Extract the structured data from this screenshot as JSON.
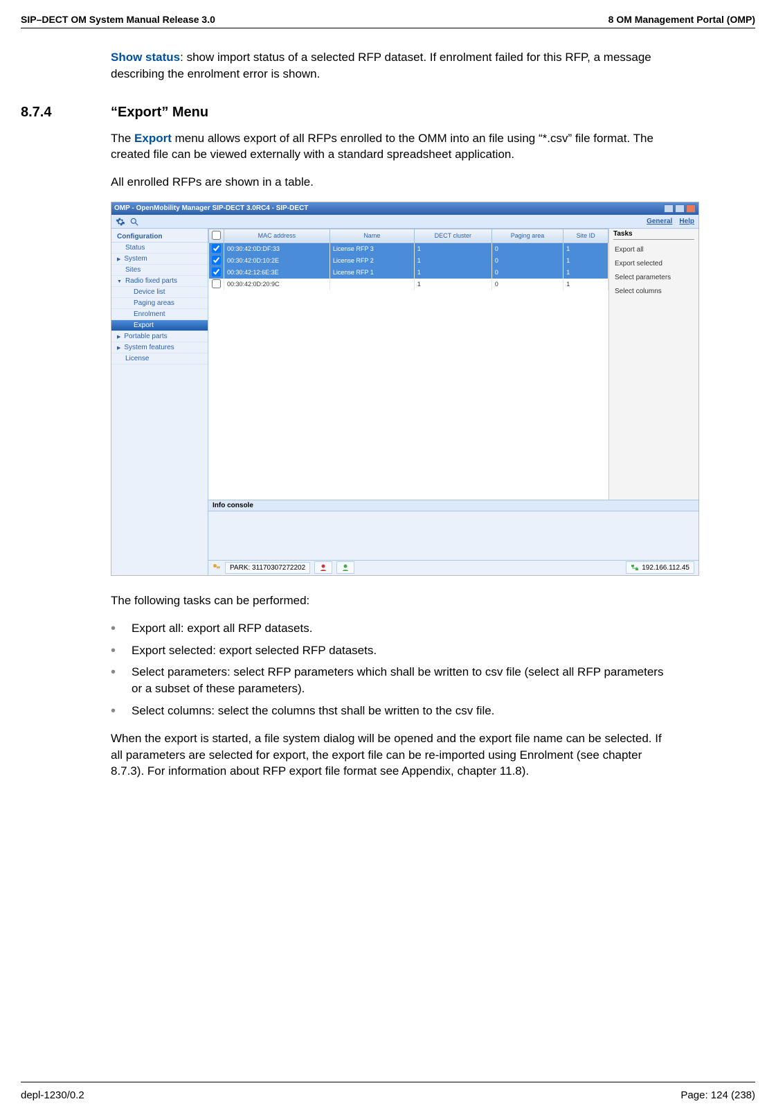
{
  "header": {
    "left": "SIP–DECT OM System Manual Release 3.0",
    "right": "8 OM Management Portal (OMP)"
  },
  "intro": {
    "show_status_label": "Show status",
    "show_status_text": ": show import status of a selected RFP dataset. If enrolment failed for this RFP, a message describing the enrolment error is shown."
  },
  "section": {
    "num": "8.7.4",
    "title": "“Export” Menu"
  },
  "body": {
    "p1a": "The ",
    "p1_export": "Export",
    "p1b": " menu allows export of all RFPs enrolled to the OMM into an file using “*.csv” file format. The created file can be viewed externally with a standard spreadsheet application.",
    "p2": "All enrolled RFPs are shown in a table.",
    "p3": "The following tasks can be performed:",
    "p4": "When the export is started, a file system dialog will be opened and the export file name can be selected. If all parameters are selected for export, the export file can be re-imported using Enrolment (see chapter 8.7.3). For information about RFP export file format see Appendix, chapter 11.8)."
  },
  "bullets": [
    {
      "label": "Export all",
      "text": ": export all RFP datasets."
    },
    {
      "label": "Export selected",
      "text": ": export selected RFP datasets."
    },
    {
      "label": "Select parameters",
      "text": ": select RFP parameters which shall be written to csv file (select all RFP parameters or a subset of these parameters)."
    },
    {
      "label": "Select columns",
      "text": ": select the columns thst shall be written to the csv file."
    }
  ],
  "screenshot": {
    "title": "OMP - OpenMobility Manager SIP-DECT 3.0RC4 - SIP-DECT",
    "toolbar_links": [
      "General",
      "Help"
    ],
    "sidebar": {
      "header": "Configuration",
      "items": [
        {
          "label": "Status",
          "indent": 1
        },
        {
          "label": "System",
          "indent": 1,
          "arrow": "right"
        },
        {
          "label": "Sites",
          "indent": 1
        },
        {
          "label": "Radio fixed parts",
          "indent": 1,
          "arrow": "down"
        },
        {
          "label": "Device list",
          "indent": 2
        },
        {
          "label": "Paging areas",
          "indent": 2
        },
        {
          "label": "Enrolment",
          "indent": 2
        },
        {
          "label": "Export",
          "indent": 2,
          "selected": true
        },
        {
          "label": "Portable parts",
          "indent": 1,
          "arrow": "right"
        },
        {
          "label": "System features",
          "indent": 1,
          "arrow": "right"
        },
        {
          "label": "License",
          "indent": 1
        }
      ]
    },
    "table": {
      "columns": [
        "",
        "MAC address",
        "Name",
        "DECT cluster",
        "Paging area",
        "Site ID"
      ],
      "rows": [
        {
          "checked": true,
          "mac": "00:30:42:0D:DF:33",
          "name": "License RFP 3",
          "cluster": "1",
          "paging": "0",
          "site": "1",
          "selected": true
        },
        {
          "checked": true,
          "mac": "00:30:42:0D:10:2E",
          "name": "License RFP 2",
          "cluster": "1",
          "paging": "0",
          "site": "1",
          "selected": true
        },
        {
          "checked": true,
          "mac": "00:30:42:12:6E:3E",
          "name": "License RFP 1",
          "cluster": "1",
          "paging": "0",
          "site": "1",
          "selected": true
        },
        {
          "checked": false,
          "mac": "00:30:42:0D:20:9C",
          "name": "",
          "cluster": "1",
          "paging": "0",
          "site": "1",
          "selected": false
        }
      ]
    },
    "tasks": {
      "header": "Tasks",
      "items": [
        "Export all",
        "Export selected",
        "Select parameters",
        "Select columns"
      ]
    },
    "info_console": "Info console",
    "status": {
      "park": "PARK: 31170307272202",
      "ip": "192.166.112.45"
    }
  },
  "footer": {
    "left": "depl-1230/0.2",
    "right": "Page: 124 (238)"
  }
}
